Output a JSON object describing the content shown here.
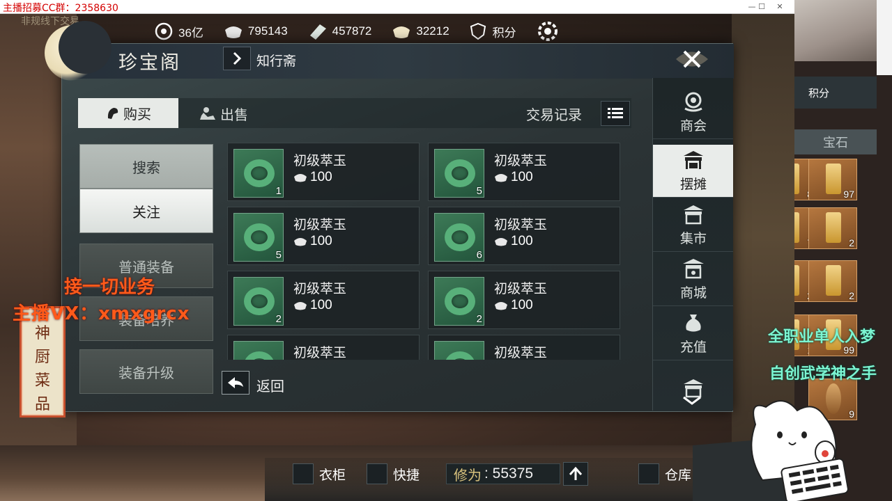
{
  "window": {
    "title": "主播招募CC群：2358630",
    "subtitle": "非规线下交易"
  },
  "currency": [
    {
      "icon": "coin-stack-icon",
      "value": "36亿"
    },
    {
      "icon": "silver-ingot-icon",
      "value": "795143"
    },
    {
      "icon": "jade-ticket-icon",
      "value": "457872"
    },
    {
      "icon": "gold-ingot-icon",
      "value": "32212"
    }
  ],
  "score_label": "积分",
  "panel": {
    "title": "珍宝阁",
    "sub_nav": "知行斋"
  },
  "tabs": {
    "buy": "购买",
    "sell": "出售"
  },
  "records_label": "交易记录",
  "categories": [
    {
      "label": "搜索",
      "state": "normal"
    },
    {
      "label": "关注",
      "state": "active"
    },
    {
      "label": "普通装备",
      "state": "dim"
    },
    {
      "label": "装备培养",
      "state": "dim"
    },
    {
      "label": "装备升级",
      "state": "dim"
    }
  ],
  "listings": [
    {
      "name": "初级萃玉",
      "price": "100",
      "qty": "1"
    },
    {
      "name": "初级萃玉",
      "price": "100",
      "qty": "5"
    },
    {
      "name": "初级萃玉",
      "price": "100",
      "qty": "5"
    },
    {
      "name": "初级萃玉",
      "price": "100",
      "qty": "6"
    },
    {
      "name": "初级萃玉",
      "price": "100",
      "qty": "2"
    },
    {
      "name": "初级萃玉",
      "price": "100",
      "qty": "2"
    },
    {
      "name": "初级萃玉",
      "price": "",
      "qty": ""
    },
    {
      "name": "初级萃玉",
      "price": "",
      "qty": ""
    }
  ],
  "back_label": "返回",
  "right_nav": [
    {
      "label": "商会",
      "icon": "guild-emblem-icon",
      "active": false
    },
    {
      "label": "摆摊",
      "icon": "stall-icon",
      "active": true
    },
    {
      "label": "集市",
      "icon": "market-icon",
      "active": false
    },
    {
      "label": "商城",
      "icon": "mall-icon",
      "active": false
    },
    {
      "label": "充值",
      "icon": "money-bag-icon",
      "active": false
    },
    {
      "label": "",
      "icon": "shop-icon",
      "active": false
    }
  ],
  "banner": [
    "神",
    "厨",
    "菜",
    "品"
  ],
  "overlay": {
    "business": "接一切业务",
    "vx": "主播VX：xmxgrcx",
    "solo": "全职业单人入梦",
    "martial": "自创武学神之手"
  },
  "bottom": {
    "wardrobe": "衣柜",
    "shortcut": "快捷",
    "cultivation_label": "修为",
    "cultivation_value": ": 55375",
    "storage": "仓库"
  },
  "side_view": {
    "score": "积分",
    "gem_tab": "宝石",
    "slots": [
      "8",
      "97",
      "7",
      "2",
      "2",
      "2",
      "1",
      "99",
      "9"
    ]
  },
  "colors": {
    "accent": "#e9ecea",
    "overlay_orange": "#ff5a1a",
    "overlay_teal": "#7cf5d2",
    "jade": "#58b07a"
  }
}
